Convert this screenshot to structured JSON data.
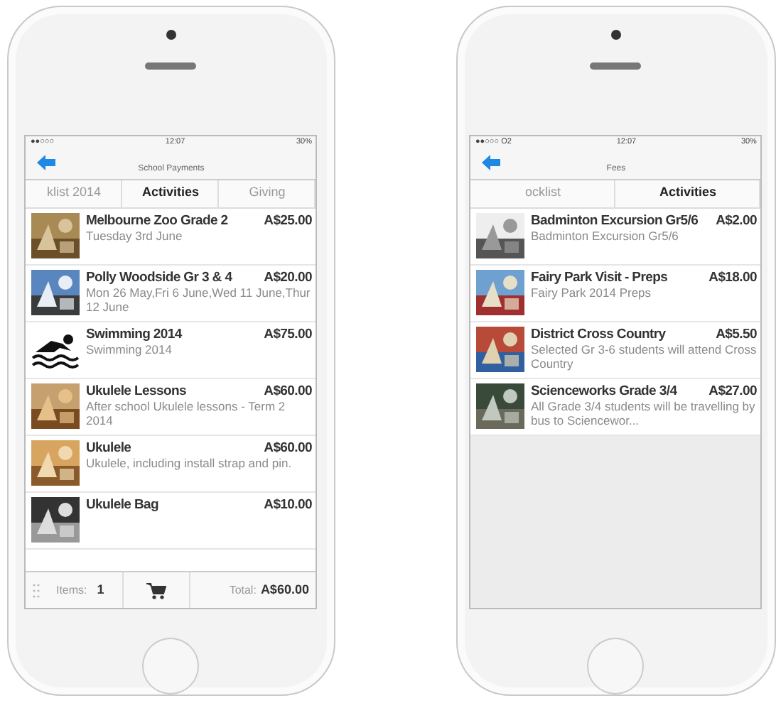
{
  "phones": [
    {
      "status": {
        "carrier": "●●○○○",
        "time": "12:07",
        "battery": "30%"
      },
      "title": "School Payments",
      "tabs": [
        {
          "label": "klist 2014",
          "selected": false
        },
        {
          "label": "Activities",
          "selected": true
        },
        {
          "label": "Giving",
          "selected": false
        }
      ],
      "items": [
        {
          "kind": "picture",
          "title": "Melbourne Zoo Grade 2",
          "price": "A$25.00",
          "description": "Tuesday 3rd June"
        },
        {
          "kind": "picture",
          "title": "Polly Woodside Gr 3 & 4",
          "price": "A$20.00",
          "description": "Mon 26 May,Fri 6 June,Wed 11 June,Thur 12 June"
        },
        {
          "kind": "swimmer",
          "title": "Swimming 2014",
          "price": "A$75.00",
          "description": "Swimming 2014"
        },
        {
          "kind": "picture",
          "title": "Ukulele Lessons",
          "price": "A$60.00",
          "description": "After school Ukulele lessons - Term 2 2014"
        },
        {
          "kind": "picture",
          "title": "Ukulele",
          "price": "A$60.00",
          "description": "Ukulele, including install strap and pin."
        },
        {
          "kind": "picture",
          "title": "Ukulele Bag",
          "price": "A$10.00"
        }
      ],
      "footer": {
        "items_label": "Items:",
        "items_count": "1",
        "total_label": "Total:",
        "total": "A$60.00"
      }
    },
    {
      "status": {
        "carrier": "●●○○○ O2",
        "time": "12:07",
        "battery": "30%"
      },
      "title": "Fees",
      "tabs": [
        {
          "label": "ocklist",
          "selected": false
        },
        {
          "label": "Activities",
          "selected": true
        }
      ],
      "items": [
        {
          "kind": "picture",
          "title": "Badminton Excursion Gr5/6",
          "price": "A$2.00",
          "description": "Badminton Excursion Gr5/6"
        },
        {
          "kind": "picture",
          "title": "Fairy Park Visit - Preps",
          "price": "A$18.00",
          "description": "Fairy Park 2014 Preps"
        },
        {
          "kind": "picture",
          "title": "District Cross Country",
          "price": "A$5.50",
          "description": "Selected Gr 3-6 students will attend Cross Country"
        },
        {
          "kind": "picture",
          "title": "Scienceworks Grade 3/4",
          "price": "A$27.00",
          "description": "All Grade 3/4 students will be travelling by bus to Sciencewor..."
        }
      ]
    }
  ]
}
